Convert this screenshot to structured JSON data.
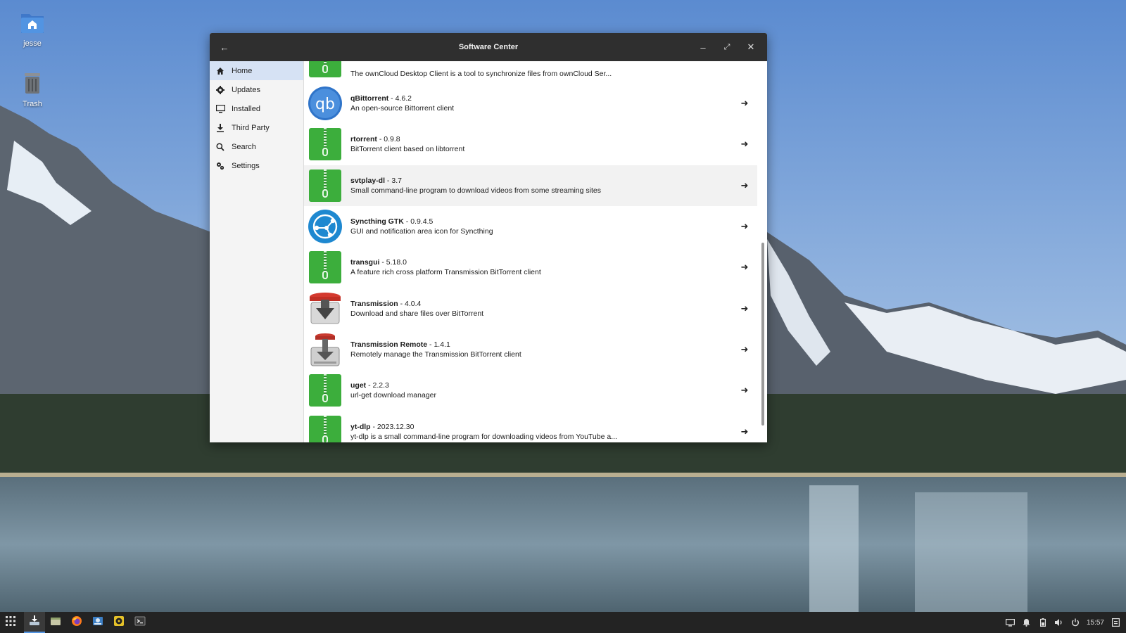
{
  "desktop": {
    "icons": [
      {
        "label": "jesse",
        "icon": "home-folder-icon"
      },
      {
        "label": "Trash",
        "icon": "trash-icon"
      }
    ]
  },
  "window": {
    "title": "Software Center",
    "controls": {
      "back": "back-icon",
      "minimize": "minimize-icon",
      "maximize": "maximize-icon",
      "close": "close-icon"
    }
  },
  "sidebar": {
    "items": [
      {
        "label": "Home",
        "icon": "home-icon",
        "active": true
      },
      {
        "label": "Updates",
        "icon": "gear-icon"
      },
      {
        "label": "Installed",
        "icon": "monitor-icon"
      },
      {
        "label": "Third Party",
        "icon": "download-icon"
      },
      {
        "label": "Search",
        "icon": "search-icon"
      },
      {
        "label": "Settings",
        "icon": "settings-icon"
      }
    ]
  },
  "apps": [
    {
      "name": "",
      "version": "",
      "description": "The ownCloud Desktop Client is a tool to synchronize files from ownCloud Ser...",
      "icon": "package-icon"
    },
    {
      "name": "qBittorrent",
      "version": "4.6.2",
      "description": "An open-source Bittorrent client",
      "icon": "qbittorrent-icon"
    },
    {
      "name": "rtorrent",
      "version": "0.9.8",
      "description": "BitTorrent client based on libtorrent",
      "icon": "package-icon"
    },
    {
      "name": "svtplay-dl",
      "version": "3.7",
      "description": "Small command-line program to download videos from some streaming sites",
      "icon": "package-icon"
    },
    {
      "name": "Syncthing GTK",
      "version": "0.9.4.5",
      "description": "GUI and notification area icon for Syncthing",
      "icon": "syncthing-icon"
    },
    {
      "name": "transgui",
      "version": "5.18.0",
      "description": "A feature rich cross platform Transmission BitTorrent client",
      "icon": "package-icon"
    },
    {
      "name": "Transmission",
      "version": "4.0.4",
      "description": "Download and share files over BitTorrent",
      "icon": "transmission-icon"
    },
    {
      "name": "Transmission Remote",
      "version": "1.4.1",
      "description": "Remotely manage the Transmission BitTorrent client",
      "icon": "transmission-remote-icon"
    },
    {
      "name": "uget",
      "version": "2.2.3",
      "description": "url-get download manager",
      "icon": "package-icon"
    },
    {
      "name": "yt-dlp",
      "version": "2023.12.30",
      "description": "yt-dlp is a small command-line program for downloading videos from YouTube a...",
      "icon": "package-icon"
    }
  ],
  "separator": " - ",
  "taskbar": {
    "apps": [
      "app-grid-icon",
      "software-center-icon",
      "file-manager-icon",
      "firefox-icon",
      "image-viewer-icon",
      "music-player-icon",
      "terminal-icon"
    ],
    "tray": [
      "display-icon",
      "bell-icon",
      "battery-icon",
      "volume-icon",
      "power-icon"
    ],
    "clock": "15:57"
  },
  "colors": {
    "accent": "#5294e2",
    "package_green": "#3cae3c",
    "titlebar": "#2f2f2f"
  }
}
